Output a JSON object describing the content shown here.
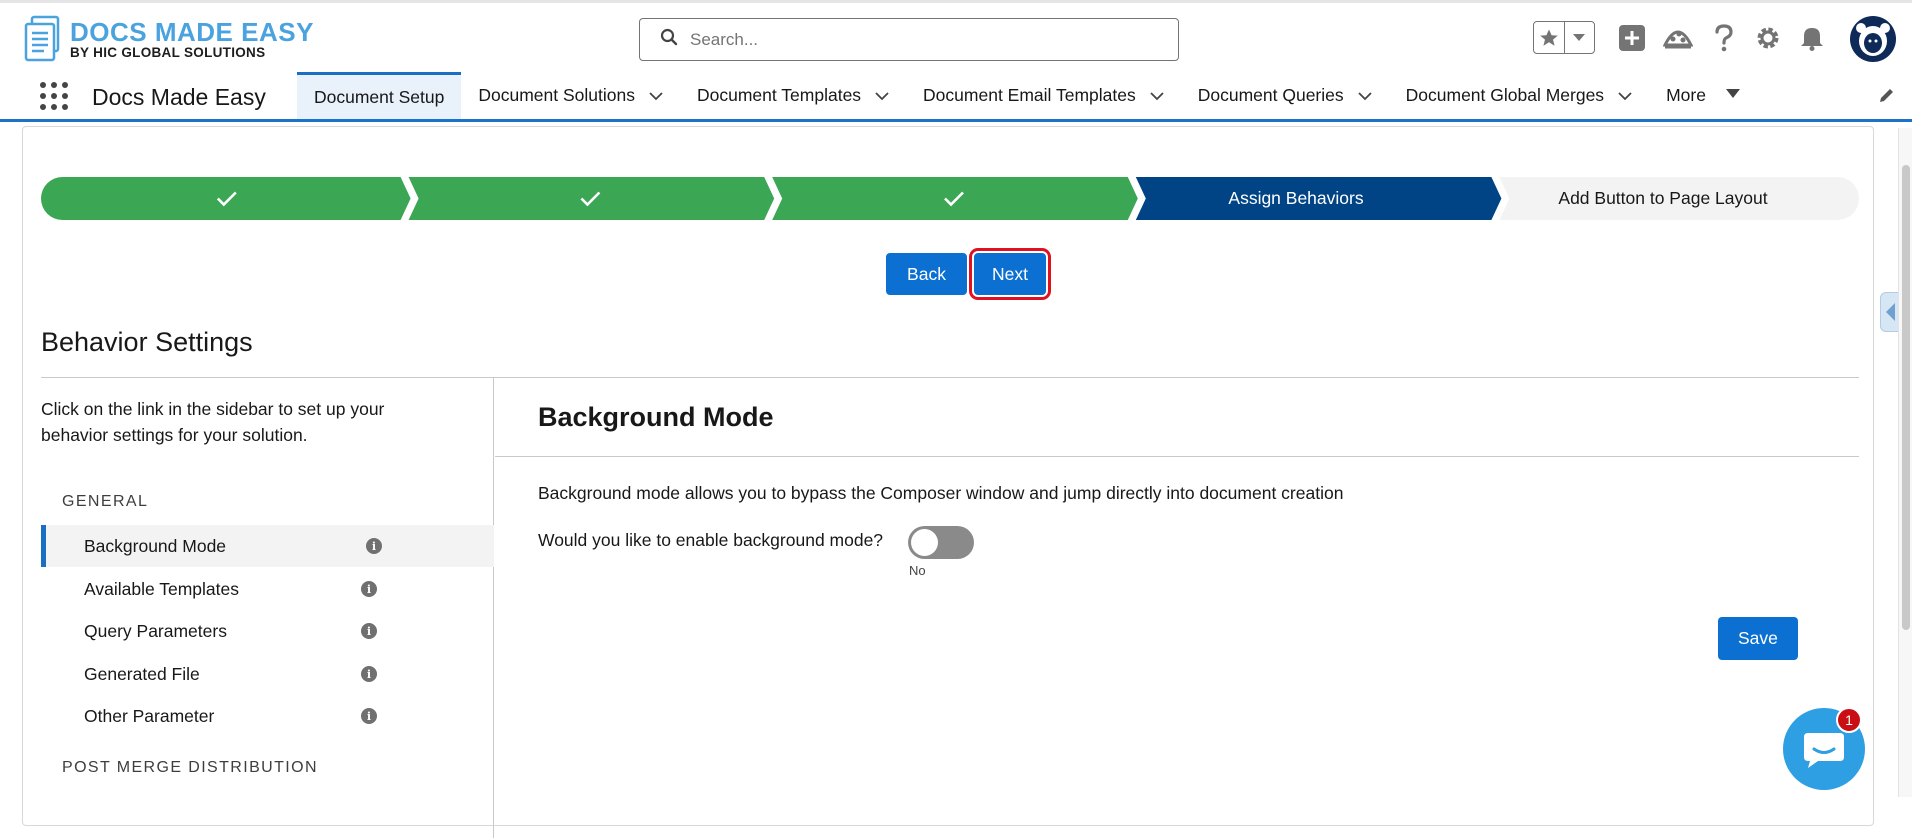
{
  "brand": {
    "title": "DOCS MADE EASY",
    "subtitle": "BY HIC GLOBAL SOLUTIONS"
  },
  "search": {
    "placeholder": "Search..."
  },
  "nav": {
    "app_name": "Docs Made Easy",
    "tabs": [
      {
        "label": "Document Setup",
        "active": true,
        "dropdown": false
      },
      {
        "label": "Document Solutions",
        "dropdown": true
      },
      {
        "label": "Document Templates",
        "dropdown": true
      },
      {
        "label": "Document Email Templates",
        "dropdown": true
      },
      {
        "label": "Document Queries",
        "dropdown": true
      },
      {
        "label": "Document Global Merges",
        "dropdown": true
      },
      {
        "label": "More",
        "dropdown": true
      }
    ]
  },
  "path": {
    "steps": [
      {
        "status": "complete",
        "label": ""
      },
      {
        "status": "complete",
        "label": ""
      },
      {
        "status": "complete",
        "label": ""
      },
      {
        "status": "current",
        "label": "Assign Behaviors"
      },
      {
        "status": "upcoming",
        "label": "Add Button to Page Layout"
      }
    ],
    "colors": {
      "complete": "#3ba755",
      "current": "#014486",
      "upcoming": "#f3f3f3"
    }
  },
  "wizard": {
    "back_label": "Back",
    "next_label": "Next"
  },
  "section": {
    "title": "Behavior Settings"
  },
  "sidebar": {
    "intro": "Click on the link in the sidebar to set up your behavior settings for your solution.",
    "groups": [
      {
        "label": "GENERAL",
        "items": [
          {
            "label": "Background Mode",
            "active": true
          },
          {
            "label": "Available Templates"
          },
          {
            "label": "Query Parameters"
          },
          {
            "label": "Generated File"
          },
          {
            "label": "Other Parameter"
          }
        ]
      },
      {
        "label": "POST MERGE DISTRIBUTION",
        "items": []
      }
    ]
  },
  "panel": {
    "title": "Background Mode",
    "description": "Background mode allows you to bypass the Composer window and jump directly into document creation",
    "question": "Would you like to enable background mode?",
    "toggle_state": "No",
    "save_label": "Save"
  },
  "chat": {
    "badge_count": "1"
  }
}
